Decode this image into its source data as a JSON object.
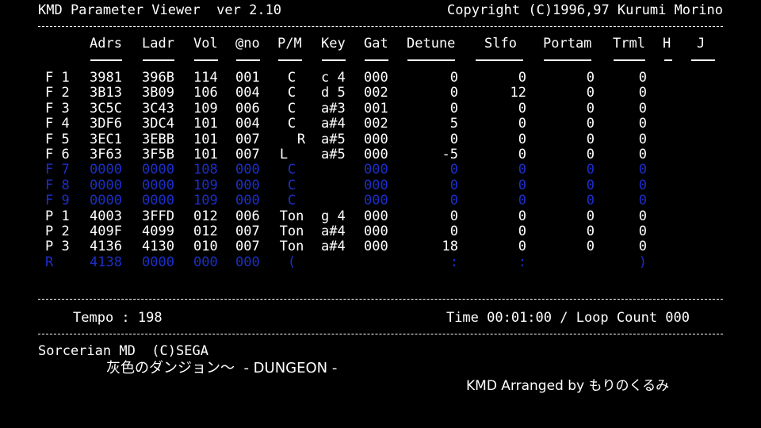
{
  "header": {
    "title": "KMD Parameter Viewer  ver 2.10",
    "copyright": "Copyright (C)1996,97 Kurumi Morino"
  },
  "columns": [
    "Adrs",
    "Ladr",
    "Vol",
    "@no",
    "P/M",
    "Key",
    "Gat",
    "Detune",
    "Slfo",
    "Portam",
    "Trml",
    "H",
    "J"
  ],
  "rows": [
    {
      "ch": "F 1",
      "adrs": "3981",
      "ladr": "396B",
      "vol": "114",
      "no": "001",
      "pm": "C",
      "key": "c 4",
      "gat": "000",
      "detune": "0",
      "slfo": "0",
      "portam": "0",
      "trml": "0",
      "dim": false
    },
    {
      "ch": "F 2",
      "adrs": "3B13",
      "ladr": "3B09",
      "vol": "106",
      "no": "004",
      "pm": "C",
      "key": "d 5",
      "gat": "002",
      "detune": "0",
      "slfo": "12",
      "portam": "0",
      "trml": "0",
      "dim": false
    },
    {
      "ch": "F 3",
      "adrs": "3C5C",
      "ladr": "3C43",
      "vol": "109",
      "no": "006",
      "pm": "C",
      "key": "a#3",
      "gat": "001",
      "detune": "0",
      "slfo": "0",
      "portam": "0",
      "trml": "0",
      "dim": false
    },
    {
      "ch": "F 4",
      "adrs": "3DF6",
      "ladr": "3DC4",
      "vol": "101",
      "no": "004",
      "pm": "C",
      "key": "a#4",
      "gat": "002",
      "detune": "5",
      "slfo": "0",
      "portam": "0",
      "trml": "0",
      "dim": false
    },
    {
      "ch": "F 5",
      "adrs": "3EC1",
      "ladr": "3EBB",
      "vol": "101",
      "no": "007",
      "pm": "R",
      "key": "a#5",
      "gat": "000",
      "detune": "0",
      "slfo": "0",
      "portam": "0",
      "trml": "0",
      "dim": false
    },
    {
      "ch": "F 6",
      "adrs": "3F63",
      "ladr": "3F5B",
      "vol": "101",
      "no": "007",
      "pm": "L",
      "key": "a#5",
      "gat": "000",
      "detune": "-5",
      "slfo": "0",
      "portam": "0",
      "trml": "0",
      "dim": false
    },
    {
      "ch": "F 7",
      "adrs": "0000",
      "ladr": "0000",
      "vol": "108",
      "no": "000",
      "pm": "C",
      "key": "",
      "gat": "000",
      "detune": "0",
      "slfo": "0",
      "portam": "0",
      "trml": "0",
      "dim": true
    },
    {
      "ch": "F 8",
      "adrs": "0000",
      "ladr": "0000",
      "vol": "109",
      "no": "000",
      "pm": "C",
      "key": "",
      "gat": "000",
      "detune": "0",
      "slfo": "0",
      "portam": "0",
      "trml": "0",
      "dim": true
    },
    {
      "ch": "F 9",
      "adrs": "0000",
      "ladr": "0000",
      "vol": "109",
      "no": "000",
      "pm": "C",
      "key": "",
      "gat": "000",
      "detune": "0",
      "slfo": "0",
      "portam": "0",
      "trml": "0",
      "dim": true
    },
    {
      "ch": "P 1",
      "adrs": "4003",
      "ladr": "3FFD",
      "vol": "012",
      "no": "006",
      "pm": "Ton",
      "key": "g 4",
      "gat": "000",
      "detune": "0",
      "slfo": "0",
      "portam": "0",
      "trml": "0",
      "dim": false
    },
    {
      "ch": "P 2",
      "adrs": "409F",
      "ladr": "4099",
      "vol": "012",
      "no": "007",
      "pm": "Ton",
      "key": "a#4",
      "gat": "000",
      "detune": "0",
      "slfo": "0",
      "portam": "0",
      "trml": "0",
      "dim": false
    },
    {
      "ch": "P 3",
      "adrs": "4136",
      "ladr": "4130",
      "vol": "010",
      "no": "007",
      "pm": "Ton",
      "key": "a#4",
      "gat": "000",
      "detune": "18",
      "slfo": "0",
      "portam": "0",
      "trml": "0",
      "dim": false
    },
    {
      "ch": "R",
      "adrs": "4138",
      "ladr": "0000",
      "vol": "000",
      "no": "000",
      "pm": "(",
      "key": "",
      "gat": "",
      "detune": ":",
      "slfo": ":",
      "portam": "",
      "trml": ")",
      "dim": true
    }
  ],
  "status": {
    "tempo_label": "Tempo : 198",
    "time_label": "Time 00:01:00 / Loop Count 000"
  },
  "song": {
    "game": "Sorcerian MD  (C)SEGA",
    "title": "灰色のダンジョン～  - DUNGEON -",
    "arranger": "KMD Arranged by もりのくるみ"
  },
  "colors": {
    "background": "#000000",
    "text": "#ffffff",
    "inactive": "#1c2fc8"
  }
}
